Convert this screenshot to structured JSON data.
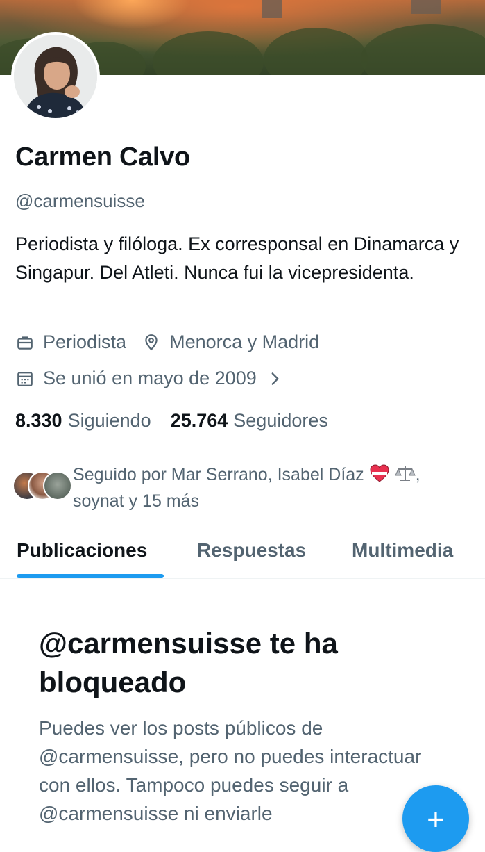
{
  "profile": {
    "name": "Carmen Calvo",
    "handle": "@carmensuisse",
    "bio": "Periodista y filóloga. Ex corresponsal en Dinamarca y Singapur. Del Atleti. Nunca fui la vicepresidenta.",
    "profession": "Periodista",
    "location": "Menorca y Madrid",
    "joined": "Se unió en mayo de 2009",
    "following_count": "8.330",
    "following_label": "Siguiendo",
    "followers_count": "25.764",
    "followers_label": "Seguidores",
    "followed_by_text": "Seguido por Mar Serrano, Isabel Díaz",
    "followed_by_rest": ", soynat y 15 más"
  },
  "icons": {
    "profession": "briefcase-icon",
    "location": "location-pin-icon",
    "joined": "calendar-icon",
    "joined_more": "chevron-right-icon",
    "emoji1": "heart-emoji",
    "emoji2": "scales-emoji",
    "fab": "plus-icon"
  },
  "tabs": [
    {
      "label": "Publicaciones",
      "active": true
    },
    {
      "label": "Respuestas",
      "active": false
    },
    {
      "label": "Multimedia",
      "active": false
    }
  ],
  "blocked": {
    "title": "@carmensuisse te ha bloqueado",
    "body": "Puedes ver los posts públicos de @carmensuisse, pero no puedes interactuar con ellos. Tampoco puedes seguir a @carmensuisse ni enviarle"
  },
  "fab": {
    "label": "+"
  },
  "colors": {
    "accent": "#1d9bf0",
    "text_primary": "#0f1419",
    "text_secondary": "#536471"
  }
}
